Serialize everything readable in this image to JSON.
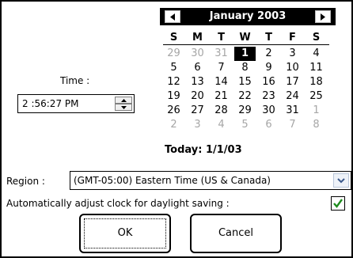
{
  "time": {
    "label": "Time :",
    "value": "2 :56:27 PM"
  },
  "calendar": {
    "title": "January 2003",
    "weekdays": [
      "S",
      "M",
      "T",
      "W",
      "T",
      "F",
      "S"
    ],
    "weeks": [
      [
        {
          "d": "29",
          "o": true
        },
        {
          "d": "30",
          "o": true
        },
        {
          "d": "31",
          "o": true
        },
        {
          "d": "1",
          "sel": true
        },
        {
          "d": "2"
        },
        {
          "d": "3"
        },
        {
          "d": "4"
        }
      ],
      [
        {
          "d": "5"
        },
        {
          "d": "6"
        },
        {
          "d": "7"
        },
        {
          "d": "8"
        },
        {
          "d": "9"
        },
        {
          "d": "10"
        },
        {
          "d": "11"
        }
      ],
      [
        {
          "d": "12"
        },
        {
          "d": "13"
        },
        {
          "d": "14"
        },
        {
          "d": "15"
        },
        {
          "d": "16"
        },
        {
          "d": "17"
        },
        {
          "d": "18"
        }
      ],
      [
        {
          "d": "19"
        },
        {
          "d": "20"
        },
        {
          "d": "21"
        },
        {
          "d": "22"
        },
        {
          "d": "23"
        },
        {
          "d": "24"
        },
        {
          "d": "25"
        }
      ],
      [
        {
          "d": "26"
        },
        {
          "d": "27"
        },
        {
          "d": "28"
        },
        {
          "d": "29"
        },
        {
          "d": "30"
        },
        {
          "d": "31"
        },
        {
          "d": "1",
          "o": true
        }
      ],
      [
        {
          "d": "2",
          "o": true
        },
        {
          "d": "3",
          "o": true
        },
        {
          "d": "4",
          "o": true
        },
        {
          "d": "5",
          "o": true
        },
        {
          "d": "6",
          "o": true
        },
        {
          "d": "7",
          "o": true
        },
        {
          "d": "8",
          "o": true
        }
      ]
    ],
    "today": "Today: 1/1/03"
  },
  "region": {
    "label": "Region :",
    "value": "(GMT-05:00) Eastern Time (US & Canada)"
  },
  "dst": {
    "label": "Automatically adjust clock for daylight saving :",
    "checked": true
  },
  "buttons": {
    "ok": "OK",
    "cancel": "Cancel"
  },
  "colors": {
    "checkmark": "#1e8c1e",
    "dropdown_arrow": "#3c5a8c",
    "other_month_day": "#a6a6a6"
  }
}
